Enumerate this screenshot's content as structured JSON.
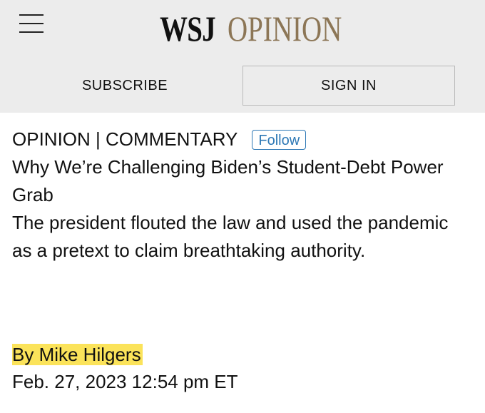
{
  "header": {
    "menu_icon": "hamburger-menu-icon",
    "logo_wsj": "WSJ",
    "logo_opinion": "OPINION",
    "subscribe_label": "SUBSCRIBE",
    "signin_label": "SIGN IN",
    "background": "#ececec",
    "opinion_color": "#8c7656"
  },
  "article": {
    "section": "OPINION | COMMENTARY",
    "follow_label": "Follow",
    "headline": "Why We’re Challenging Biden’s Student-Debt Power Grab",
    "dek": "The president flouted the law and used the pandemic as a pretext to claim breathtaking authority.",
    "byline": "By Mike Hilgers",
    "date": "Feb. 27, 2023 12:54 pm ET",
    "highlight_color": "#fbe35a",
    "follow_color": "#2d78b5"
  }
}
